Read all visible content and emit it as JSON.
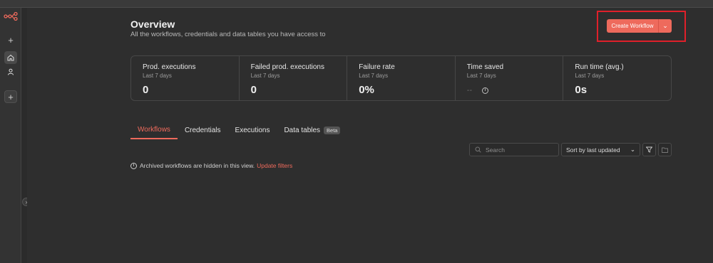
{
  "header": {
    "title": "Overview",
    "subtitle": "All the workflows, credentials and data tables you have access to",
    "create_button": "Create Workflow"
  },
  "stats": [
    {
      "name": "Prod. executions",
      "period": "Last 7 days",
      "value": "0"
    },
    {
      "name": "Failed prod. executions",
      "period": "Last 7 days",
      "value": "0"
    },
    {
      "name": "Failure rate",
      "period": "Last 7 days",
      "value": "0%"
    },
    {
      "name": "Time saved",
      "period": "Last 7 days",
      "value": "--"
    },
    {
      "name": "Run time (avg.)",
      "period": "Last 7 days",
      "value": "0s"
    }
  ],
  "tabs": [
    {
      "label": "Workflows",
      "active": true
    },
    {
      "label": "Credentials"
    },
    {
      "label": "Executions"
    },
    {
      "label": "Data tables",
      "badge": "Beta"
    }
  ],
  "toolbar": {
    "search_placeholder": "Search",
    "sort_value": "Sort by last updated"
  },
  "notice": {
    "text": "Archived workflows are hidden in this view.",
    "link": "Update filters"
  },
  "colors": {
    "accent": "#ee6a5c",
    "highlight": "#e0202a"
  }
}
